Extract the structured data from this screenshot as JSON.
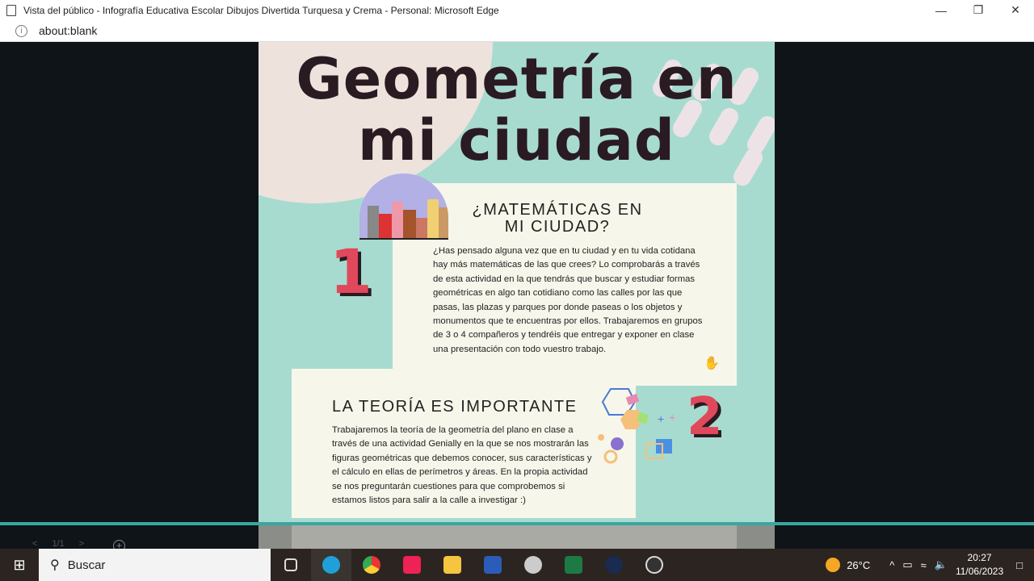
{
  "window": {
    "title": "Vista del público - Infografía Educativa Escolar Dibujos Divertida Turquesa y Crema - Personal: Microsoft Edge",
    "url": "about:blank"
  },
  "infographic": {
    "title_line1": "Geometría en",
    "title_line2": "mi ciudad",
    "section1": {
      "number": "1",
      "heading_line1": "¿MATEMÁTICAS EN",
      "heading_line2": "MI CIUDAD?",
      "body": "¿Has pensado alguna vez que en tu ciudad y en tu vida cotidana hay más matemáticas de las que crees? Lo comprobarás a través de esta actividad en la que tendrás que buscar y estudiar formas geométricas en algo tan cotidiano como las calles por las que pasas, las plazas y parques por donde paseas o los objetos y monumentos que te encuentras por ellos. Trabajaremos en grupos de 3 o 4 compañeros y tendréis que entregar y exponer en clase una presentación con todo vuestro trabajo."
    },
    "section2": {
      "number": "2",
      "heading": "LA TEORÍA ES IMPORTANTE",
      "body": "Trabajaremos la teoría de la geometría del plano en clase a través de una actividad Genially en la que se nos mostrarán las figuras geométricas que debemos conocer, sus características y el cálculo en ellas de perímetros y áreas. En la propia actividad  se nos preguntarán cuestiones para que comprobemos si estamos listos para salir a la calle a investigar :)"
    }
  },
  "viewer": {
    "page_indicator": "1/1"
  },
  "taskbar": {
    "search_placeholder": "Buscar",
    "temperature": "26°C",
    "time": "20:27",
    "date": "11/06/2023"
  },
  "colors": {
    "teal": "#a8dbd0",
    "cream": "#f7f6ea",
    "accent_red": "#e0485b"
  }
}
